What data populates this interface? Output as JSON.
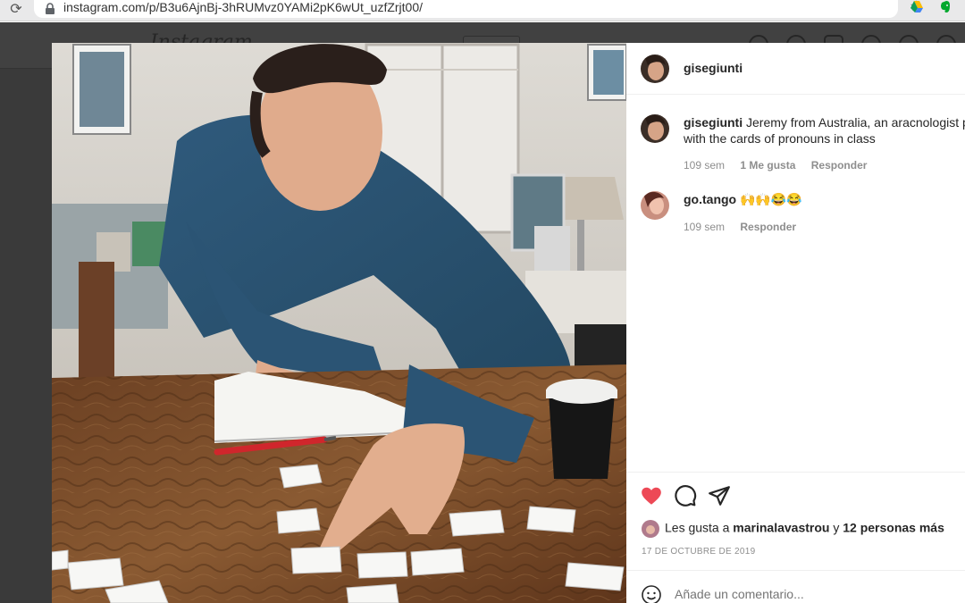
{
  "browser": {
    "url": "instagram.com/p/B3u6AjnBj-3hRUMvz0YAMi2pK6wUt_uzfZrjt00/",
    "icons": [
      "reload-icon",
      "lock-icon",
      "star-icon",
      "google-drive-icon",
      "evernote-icon"
    ]
  },
  "background_page": {
    "logo_text": "Instagram"
  },
  "post": {
    "photo_alt": "Man at a wooden table arranging paper cards with a notebook, red pen and coffee cup",
    "author": "gisegiunti",
    "comments": [
      {
        "user": "gisegiunti",
        "text_line1": "Jeremy from Australia, an aracnologist p",
        "text_line2": "with the cards of pronouns in class",
        "age": "109 sem",
        "likes": "1 Me gusta",
        "reply": "Responder"
      },
      {
        "user": "go.tango",
        "text_line1": "🙌🙌😂😂",
        "age": "109 sem",
        "reply": "Responder"
      }
    ],
    "likes": {
      "prefix": "Les gusta a ",
      "user": "marinalavastrou",
      "joiner": " y ",
      "others": "12 personas más"
    },
    "date": "17 DE OCTUBRE DE 2019",
    "add_comment_placeholder": "Añade un comentario..."
  },
  "colors": {
    "like_red": "#ed4956",
    "text": "#262626",
    "muted": "#8e8e8e"
  }
}
